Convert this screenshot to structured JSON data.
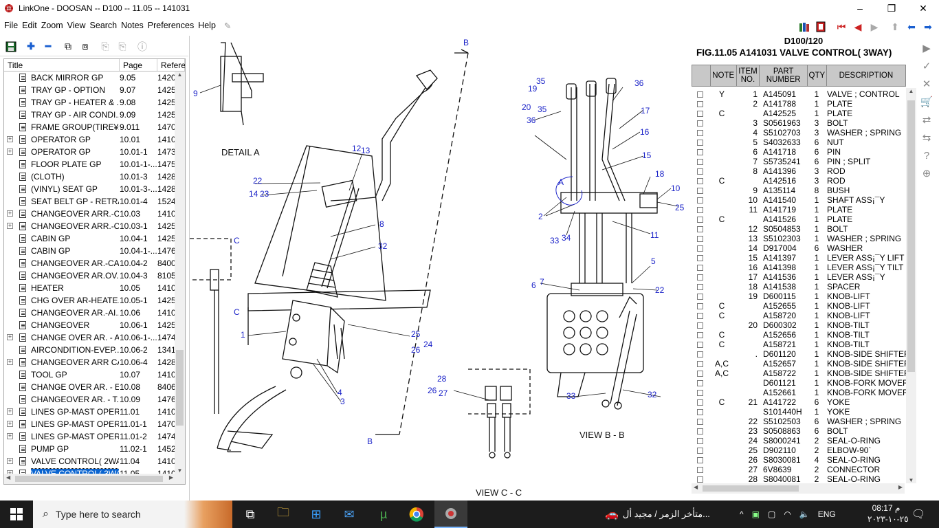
{
  "window": {
    "title": "LinkOne - DOOSAN -- D100 -- 11.05 -- 141031",
    "icon": "linkone-app-icon",
    "minimize": "–",
    "maximize": "❐",
    "close": "✕"
  },
  "menu": [
    "File",
    "Edit",
    "Zoom",
    "View",
    "Search",
    "Notes",
    "Preferences",
    "Help"
  ],
  "toolbar_icons": [
    "save-icon",
    "add-icon",
    "remove-icon",
    "copy-icon",
    "tree-icon",
    "paste-icon",
    "paste2-icon",
    "info-icon"
  ],
  "tree": {
    "columns": {
      "title": "Title",
      "page": "Page",
      "reference": "Refere..."
    },
    "rows": [
      {
        "exp": "",
        "title": "BACK MIRROR GP",
        "page": "9.05",
        "ref": "1420"
      },
      {
        "exp": "",
        "title": "TRAY GP - OPTION",
        "page": "9.07",
        "ref": "1425"
      },
      {
        "exp": "",
        "title": "TRAY GP -  HEATER & ...",
        "page": "9.08",
        "ref": "1425"
      },
      {
        "exp": "",
        "title": "TRAY GP -  AIR CONDI...",
        "page": "9.09",
        "ref": "1425"
      },
      {
        "exp": "",
        "title": "FRAME GROUP(TIRE¥±...",
        "page": "9.011",
        "ref": "1470"
      },
      {
        "exp": "+",
        "title": "OPERATOR GP",
        "page": "10.01",
        "ref": "1410"
      },
      {
        "exp": "+",
        "title": "OPERATOR GP",
        "page": "10.01-1",
        "ref": "1473"
      },
      {
        "exp": "",
        "title": "FLOOR PLATE GP",
        "page": "10.01-1-...",
        "ref": "1475"
      },
      {
        "exp": "",
        "title": "(CLOTH)",
        "page": "10.01-3",
        "ref": "1428"
      },
      {
        "exp": "",
        "title": "(VINYL) SEAT GP",
        "page": "10.01-3-...",
        "ref": "1428"
      },
      {
        "exp": "",
        "title": "SEAT BELT GP - RETRA...",
        "page": "10.01-4",
        "ref": "1524"
      },
      {
        "exp": "+",
        "title": "CHANGEOVER ARR.-C...",
        "page": "10.03",
        "ref": "1410"
      },
      {
        "exp": "+",
        "title": "CHANGEOVER ARR.-C...",
        "page": "10.03-1",
        "ref": "1425"
      },
      {
        "exp": "",
        "title": "CABIN GP",
        "page": "10.04-1",
        "ref": "1425"
      },
      {
        "exp": "",
        "title": "CABIN GP",
        "page": "10.04-1-...",
        "ref": "1476"
      },
      {
        "exp": "",
        "title": "CHANGEOVER AR.-CA...",
        "page": "10.04-2",
        "ref": "8400"
      },
      {
        "exp": "",
        "title": "CHANGEOVER AR.OV...",
        "page": "10.04-3",
        "ref": "8105"
      },
      {
        "exp": "",
        "title": "HEATER",
        "page": "10.05",
        "ref": "1410"
      },
      {
        "exp": "",
        "title": "CHG OVER AR-HEATE...",
        "page": "10.05-1",
        "ref": "1425"
      },
      {
        "exp": "",
        "title": "CHANGEOVER AR.-AI...",
        "page": "10.06",
        "ref": "1410"
      },
      {
        "exp": "",
        "title": "CHANGEOVER",
        "page": "10.06-1",
        "ref": "1425"
      },
      {
        "exp": "+",
        "title": "CHANGE OVER AR. - A...",
        "page": "10.06-1-...",
        "ref": "1474"
      },
      {
        "exp": "",
        "title": "AIRCONDITION-EVEP...",
        "page": "10.06-2",
        "ref": "1341"
      },
      {
        "exp": "+",
        "title": "CHANGEOVER ARR CA...",
        "page": "10.06-4",
        "ref": "1428"
      },
      {
        "exp": "",
        "title": "TOOL GP",
        "page": "10.07",
        "ref": "1410"
      },
      {
        "exp": "",
        "title": "CHANGE OVER AR. - E...",
        "page": "10.08",
        "ref": "8406"
      },
      {
        "exp": "",
        "title": "CHANGEOVER AR. - T...",
        "page": "10.09",
        "ref": "1476"
      },
      {
        "exp": "+",
        "title": "LINES GP-MAST OPER...",
        "page": "11.01",
        "ref": "1410"
      },
      {
        "exp": "+",
        "title": "LINES GP-MAST OPER...",
        "page": "11.01-1",
        "ref": "1470"
      },
      {
        "exp": "+",
        "title": "LINES GP-MAST OPER...",
        "page": "11.01-2",
        "ref": "1474"
      },
      {
        "exp": "",
        "title": "PUMP GP",
        "page": "11.02-1",
        "ref": "1452"
      },
      {
        "exp": "+",
        "title": "VALVE CONTROL( 2WA...",
        "page": "11.04",
        "ref": "1410"
      },
      {
        "exp": "+",
        "title": "VALVE CONTROL( 3WA...",
        "page": "11.05",
        "ref": "1410",
        "selected": true
      },
      {
        "exp": "+",
        "title": "VALVE CONTROL( 4WA...",
        "page": "11.06",
        "ref": "1410"
      }
    ]
  },
  "drawing": {
    "detail_a": "DETAIL  A",
    "view_bb": "VIEW  B - B",
    "view_cc": "VIEW  C - C",
    "callouts": {
      "c9": "9",
      "c12": "12",
      "c13": "13",
      "c22a": "22",
      "c14": "14",
      "c23": "23",
      "c8a": "8",
      "c32a": "32",
      "c1": "1",
      "c4": "4",
      "c3": "3",
      "c25a": "25",
      "c24": "24",
      "c26a": "26",
      "cBtop": "B",
      "cBbot": "B",
      "cC1": "C",
      "cC2": "C",
      "c35a": "35",
      "c19": "19",
      "c20": "20",
      "c35b": "35",
      "c36a": "36",
      "c36b": "36",
      "c17": "17",
      "c16": "16",
      "c15": "15",
      "cA": "A",
      "c2": "2",
      "c33a": "33",
      "c34": "34",
      "c18": "18",
      "c10": "10",
      "c25b": "25",
      "c11": "11",
      "c5": "5",
      "c6": "6",
      "c7": "7",
      "c22b": "22",
      "c33b": "33",
      "c32b": "32",
      "c28": "28",
      "c26b": "26",
      "c27": "27"
    }
  },
  "parts": {
    "model": "D100/120",
    "figure": "FIG.11.05    A141031 VALVE CONTROL( 3WAY)",
    "headers": {
      "note": "NOTE",
      "item": "ITEM NO.",
      "part": "PART NUMBER",
      "qty": "QTY",
      "desc": "DESCRIPTION"
    },
    "rows": [
      {
        "note": "Y",
        "item": "1",
        "part": "A145091",
        "qty": "1",
        "desc": "VALVE ; CONTROL"
      },
      {
        "note": "",
        "item": "2",
        "part": "A141788",
        "qty": "1",
        "desc": "PLATE"
      },
      {
        "note": "C",
        "item": "",
        "part": "A142525",
        "qty": "1",
        "desc": "PLATE"
      },
      {
        "note": "",
        "item": "3",
        "part": "S0561963",
        "qty": "3",
        "desc": "BOLT"
      },
      {
        "note": "",
        "item": "4",
        "part": "S5102703",
        "qty": "3",
        "desc": "WASHER ; SPRING"
      },
      {
        "note": "",
        "item": "5",
        "part": "S4032633",
        "qty": "6",
        "desc": "NUT"
      },
      {
        "note": "",
        "item": "6",
        "part": "A141718",
        "qty": "6",
        "desc": "PIN"
      },
      {
        "note": "",
        "item": "7",
        "part": "S5735241",
        "qty": "6",
        "desc": "PIN ; SPLIT"
      },
      {
        "note": "",
        "item": "8",
        "part": "A141396",
        "qty": "3",
        "desc": "ROD"
      },
      {
        "note": "C",
        "item": "",
        "part": "A142516",
        "qty": "3",
        "desc": "ROD"
      },
      {
        "note": "",
        "item": "9",
        "part": "A135114",
        "qty": "8",
        "desc": "BUSH"
      },
      {
        "note": "",
        "item": "10",
        "part": "A141540",
        "qty": "1",
        "desc": "SHAFT ASS¡¯Y"
      },
      {
        "note": "",
        "item": "11",
        "part": "A141719",
        "qty": "1",
        "desc": "PLATE"
      },
      {
        "note": "C",
        "item": "",
        "part": "A141526",
        "qty": "1",
        "desc": "PLATE"
      },
      {
        "note": "",
        "item": "12",
        "part": "S0504853",
        "qty": "1",
        "desc": "BOLT"
      },
      {
        "note": "",
        "item": "13",
        "part": "S5102303",
        "qty": "1",
        "desc": "WASHER ; SPRING"
      },
      {
        "note": "",
        "item": "14",
        "part": "D917004",
        "qty": "6",
        "desc": "WASHER"
      },
      {
        "note": "",
        "item": "15",
        "part": "A141397",
        "qty": "1",
        "desc": "LEVER ASS¡¯Y LIFT"
      },
      {
        "note": "",
        "item": "16",
        "part": "A141398",
        "qty": "1",
        "desc": "LEVER ASS¡¯Y TILT"
      },
      {
        "note": "",
        "item": "17",
        "part": "A141536",
        "qty": "1",
        "desc": "LEVER ASS¡¯Y"
      },
      {
        "note": "",
        "item": "18",
        "part": "A141538",
        "qty": "1",
        "desc": "SPACER"
      },
      {
        "note": "",
        "item": "19",
        "part": "D600115",
        "qty": "1",
        "desc": "KNOB-LIFT"
      },
      {
        "note": "C",
        "item": "",
        "part": "A152655",
        "qty": "1",
        "desc": "KNOB-LIFT"
      },
      {
        "note": "C",
        "item": "",
        "part": "A158720",
        "qty": "1",
        "desc": "KNOB-LIFT"
      },
      {
        "note": "",
        "item": "20",
        "part": "D600302",
        "qty": "1",
        "desc": "KNOB-TILT"
      },
      {
        "note": "C",
        "item": "",
        "part": "A152656",
        "qty": "1",
        "desc": "KNOB-TILT"
      },
      {
        "note": "C",
        "item": "",
        "part": "A158721",
        "qty": "1",
        "desc": "KNOB-TILT"
      },
      {
        "note": "",
        "item": ".",
        "part": "D601120",
        "qty": "1",
        "desc": "KNOB-SIDE SHIFTER"
      },
      {
        "note": "A,C",
        "item": "",
        "part": "A152657",
        "qty": "1",
        "desc": "KNOB-SIDE SHIFTER"
      },
      {
        "note": "A,C",
        "item": "",
        "part": "A158722",
        "qty": "1",
        "desc": "KNOB-SIDE SHIFTER"
      },
      {
        "note": "",
        "item": "",
        "part": "D601121",
        "qty": "1",
        "desc": "KNOB-FORK MOVER"
      },
      {
        "note": "",
        "item": "",
        "part": "A152661",
        "qty": "1",
        "desc": "KNOB-FORK MOVER"
      },
      {
        "note": "C",
        "item": "21",
        "part": "A141722",
        "qty": "6",
        "desc": "YOKE"
      },
      {
        "note": "",
        "item": "",
        "part": "S101440H",
        "qty": "1",
        "desc": "YOKE"
      },
      {
        "note": "",
        "item": "22",
        "part": "S5102503",
        "qty": "6",
        "desc": "WASHER ; SPRING"
      },
      {
        "note": "",
        "item": "23",
        "part": "S0508863",
        "qty": "6",
        "desc": "BOLT"
      },
      {
        "note": "",
        "item": "24",
        "part": "S8000241",
        "qty": "2",
        "desc": "SEAL-O-RING"
      },
      {
        "note": "",
        "item": "25",
        "part": "D902110",
        "qty": "2",
        "desc": "ELBOW-90`"
      },
      {
        "note": "",
        "item": "26",
        "part": "S8030081",
        "qty": "4",
        "desc": "SEAL-O-RING"
      },
      {
        "note": "",
        "item": "27",
        "part": "6V8639",
        "qty": "2",
        "desc": "CONNECTOR"
      },
      {
        "note": "",
        "item": "28",
        "part": "S8040081",
        "qty": "2",
        "desc": "SEAL-O-RING"
      }
    ]
  },
  "right_toolbar_icons": [
    "book-icon",
    "book-red-icon",
    "first-icon",
    "prev-icon",
    "next-icon",
    "up-icon",
    "back-icon",
    "forward-icon"
  ],
  "side_toolbar_icons": [
    "play-icon",
    "check-icon",
    "x-icon",
    "cart-icon",
    "sync-icon",
    "sync2-icon",
    "help-icon",
    "zoom-icon"
  ],
  "taskbar": {
    "search_placeholder": "Type here to search",
    "news": "متأخر الزمر / مجيد أل...",
    "lang": "ENG",
    "time": "08:17 م",
    "date": "٢٥-١٠-٢٠٢٣"
  }
}
